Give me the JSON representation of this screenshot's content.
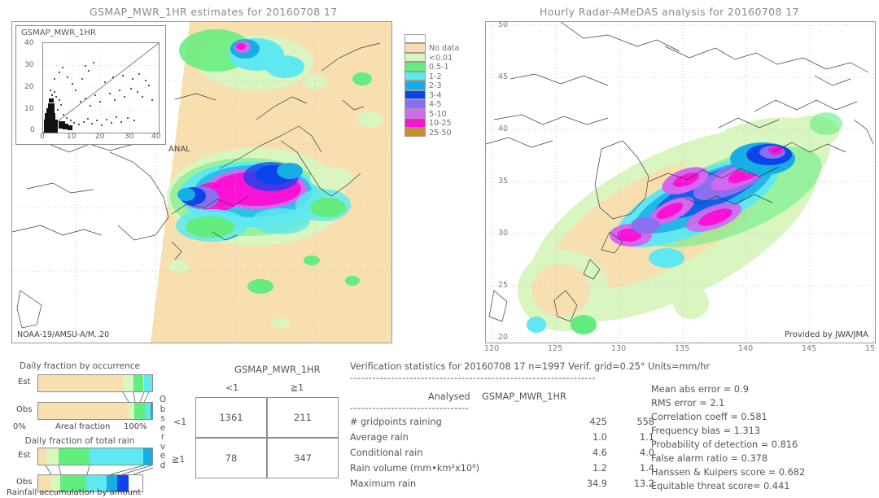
{
  "left_panel": {
    "title": "GSMAP_MWR_1HR estimates for 20160708 17",
    "attribution": "NOAA-19/AMSU-A/M..20",
    "inset": {
      "label": "GSMAP_MWR_1HR",
      "xlabel": "ANAL",
      "yticks": [
        "40",
        "30",
        "20",
        "10",
        "0"
      ],
      "xticks": [
        "0",
        "10",
        "20",
        "30",
        "40"
      ]
    }
  },
  "right_panel": {
    "title": "Hourly Radar-AMeDAS analysis for 20160708 17",
    "attribution": "Provided by JWA/JMA",
    "lon_ticks": [
      "120",
      "125",
      "130",
      "135",
      "140",
      "145",
      "15"
    ],
    "lat_ticks": [
      "50",
      "45",
      "40",
      "35",
      "30",
      "25",
      "20"
    ]
  },
  "colorbar": {
    "units": "mm/hr",
    "entries": [
      {
        "label": "No data",
        "color": "#f7dfb0"
      },
      {
        "label": "<0.01",
        "color": "#d9f5c0"
      },
      {
        "label": "0.5-1",
        "color": "#63ed7e"
      },
      {
        "label": "1-2",
        "color": "#5fe8ef"
      },
      {
        "label": "2-3",
        "color": "#17aee6"
      },
      {
        "label": "3-4",
        "color": "#0b44ec"
      },
      {
        "label": "4-5",
        "color": "#8a6ff0"
      },
      {
        "label": "5-10",
        "color": "#d268ef"
      },
      {
        "label": "10-25",
        "color": "#fb12d6"
      },
      {
        "label": "25-50",
        "color": "#cc8c26"
      }
    ],
    "top_empty": true
  },
  "contingency": {
    "title": "GSMAP_MWR_1HR",
    "col_headers": [
      "<1",
      "≧1"
    ],
    "row_headers": [
      "<1",
      "≧1"
    ],
    "observed_label": "Observed",
    "cells": [
      [
        "1361",
        "211"
      ],
      [
        "78",
        "347"
      ]
    ]
  },
  "stats": {
    "header": "Verification statistics for 20160708 17  n=1997  Verif. grid=0.25°  Units=mm/hr",
    "rule": "------------------------------------------------------------------",
    "col_headers": [
      "Analysed",
      "GSMAP_MWR_1HR"
    ],
    "subrule": "--------------------------------",
    "rows": [
      {
        "label": "# gridpoints raining",
        "analysed": "425",
        "model": "558"
      },
      {
        "label": "Average rain",
        "analysed": "1.0",
        "model": "1.1"
      },
      {
        "label": "Conditional rain",
        "analysed": "4.6",
        "model": "4.0"
      },
      {
        "label": "Rain volume (mm•km²x10⁸)",
        "analysed": "1.2",
        "model": "1.4"
      },
      {
        "label": "Maximum rain",
        "analysed": "34.9",
        "model": "13.2"
      }
    ],
    "scores": [
      "Mean abs error = 0.9",
      "RMS error = 2.1",
      "Correlation coeff = 0.581",
      "Frequency bias = 1.313",
      "Probability of detection = 0.816",
      "False alarm ratio = 0.378",
      "Hanssen & Kuipers score = 0.682",
      "Equitable threat score= 0.441"
    ]
  },
  "fraction_charts": [
    {
      "title": "Daily fraction by occurrence",
      "axis_left": "0%",
      "axis_center": "Areal fraction",
      "axis_right": "100%",
      "rows": [
        {
          "label": "Est",
          "segments": [
            {
              "color": "#f7dfb0",
              "pct": 74.0
            },
            {
              "color": "#d9f5c0",
              "pct": 9.5
            },
            {
              "color": "#63ed7e",
              "pct": 9.0
            },
            {
              "color": "#5fe8ef",
              "pct": 7.5
            }
          ]
        },
        {
          "label": "Obs",
          "segments": [
            {
              "color": "#f7dfb0",
              "pct": 79.0
            },
            {
              "color": "#d9f5c0",
              "pct": 5.0
            },
            {
              "color": "#63ed7e",
              "pct": 10.5
            },
            {
              "color": "#5fe8ef",
              "pct": 4.0
            },
            {
              "color": "#17aee6",
              "pct": 1.5
            }
          ]
        }
      ]
    },
    {
      "title": "Daily fraction of total rain",
      "axis_bottom": "Rainfall accumulation by amount",
      "rows": [
        {
          "label": "Est",
          "segments": [
            {
              "color": "#f7dfb0",
              "pct": 7.0
            },
            {
              "color": "#d9f5c0",
              "pct": 11.0
            },
            {
              "color": "#63ed7e",
              "pct": 27.0
            },
            {
              "color": "#5fe8ef",
              "pct": 47.0
            },
            {
              "color": "#17aee6",
              "pct": 8.0
            }
          ]
        },
        {
          "label": "Obs",
          "segments": [
            {
              "color": "#f7dfb0",
              "pct": 12.0
            },
            {
              "color": "#d9f5c0",
              "pct": 9.0
            },
            {
              "color": "#63ed7e",
              "pct": 25.0
            },
            {
              "color": "#5fe8ef",
              "pct": 20.0
            },
            {
              "color": "#17aee6",
              "pct": 10.0
            },
            {
              "color": "#0b44ec",
              "pct": 11.0
            }
          ]
        }
      ]
    }
  ]
}
